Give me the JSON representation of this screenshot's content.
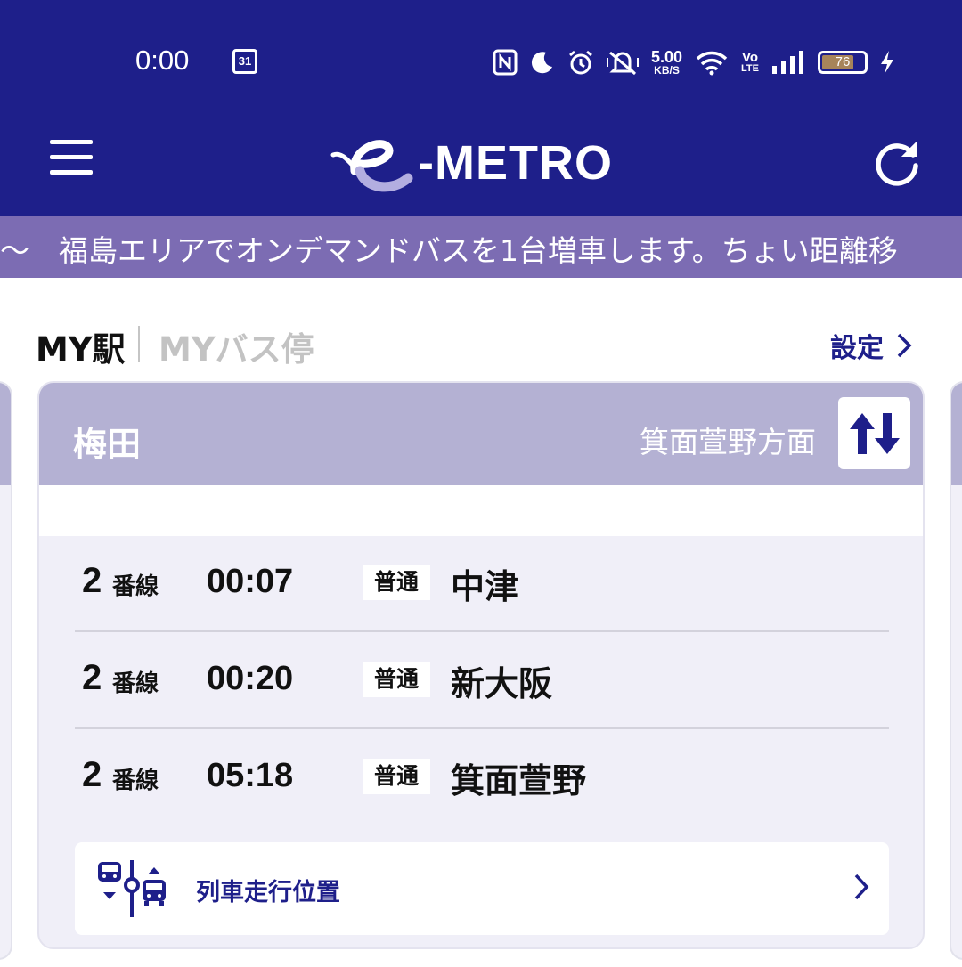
{
  "status_bar": {
    "time": "0:00",
    "calendar_day": "31",
    "network_speed": "5.00",
    "network_speed_unit": "KB/S",
    "volte_top": "Vo",
    "volte_bottom": "LTE",
    "battery_level": "76",
    "battery_fraction": 0.76,
    "icons": [
      "calendar-icon",
      "nfc-icon",
      "moon-icon",
      "alarm-icon",
      "mute-icon",
      "wifi-icon",
      "signal-icon",
      "battery-icon",
      "charging-icon"
    ]
  },
  "header": {
    "logo_text": "-METRO",
    "background": "#1e1f8a"
  },
  "ticker": {
    "text": "〜　福島エリアでオンデマンドバスを1台増車します。ちょい距離移"
  },
  "tabs": {
    "my_station": "MY駅",
    "my_bus_stop": "MYバス停",
    "settings": "設定"
  },
  "card": {
    "station": "梅田",
    "direction": "箕面萱野方面",
    "departures": [
      {
        "platform": "2",
        "platform_unit": "番線",
        "time": "00:07",
        "type": "普通",
        "destination": "中津"
      },
      {
        "platform": "2",
        "platform_unit": "番線",
        "time": "00:20",
        "type": "普通",
        "destination": "新大阪"
      },
      {
        "platform": "2",
        "platform_unit": "番線",
        "time": "05:18",
        "type": "普通",
        "destination": "箕面萱野"
      }
    ],
    "train_position_label": "列車走行位置"
  },
  "colors": {
    "navy": "#1e1f8a",
    "ticker": "#7c6cb3",
    "card_header": "#b4b1d3",
    "card_body": "#f0eff8"
  }
}
